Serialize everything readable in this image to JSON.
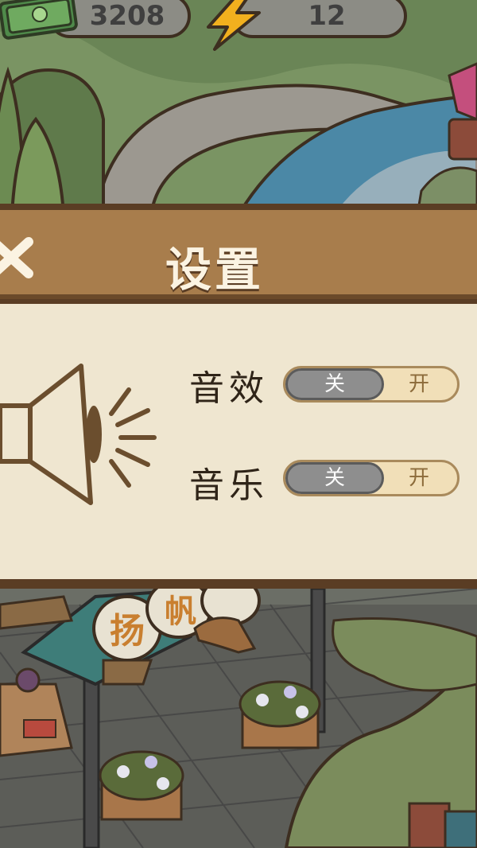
{
  "hud": {
    "coins": "3208",
    "energy": "12"
  },
  "settings": {
    "title": "设置",
    "sound_effects": {
      "label": "音效",
      "off_label": "关",
      "on_label": "开",
      "state": "off"
    },
    "music": {
      "label": "音乐",
      "off_label": "关",
      "on_label": "开",
      "state": "off"
    }
  },
  "scene": {
    "shop_sign_text": "扬帆"
  },
  "colors": {
    "panel_header": "#a87d4c",
    "panel_body": "#efe6d0",
    "toggle_off": "#8e8e8e",
    "title_text": "#fbf3e2"
  },
  "icons": {
    "coins": "cash-stack-icon",
    "energy": "lightning-icon",
    "close": "close-x-icon",
    "speaker": "speaker-icon"
  }
}
